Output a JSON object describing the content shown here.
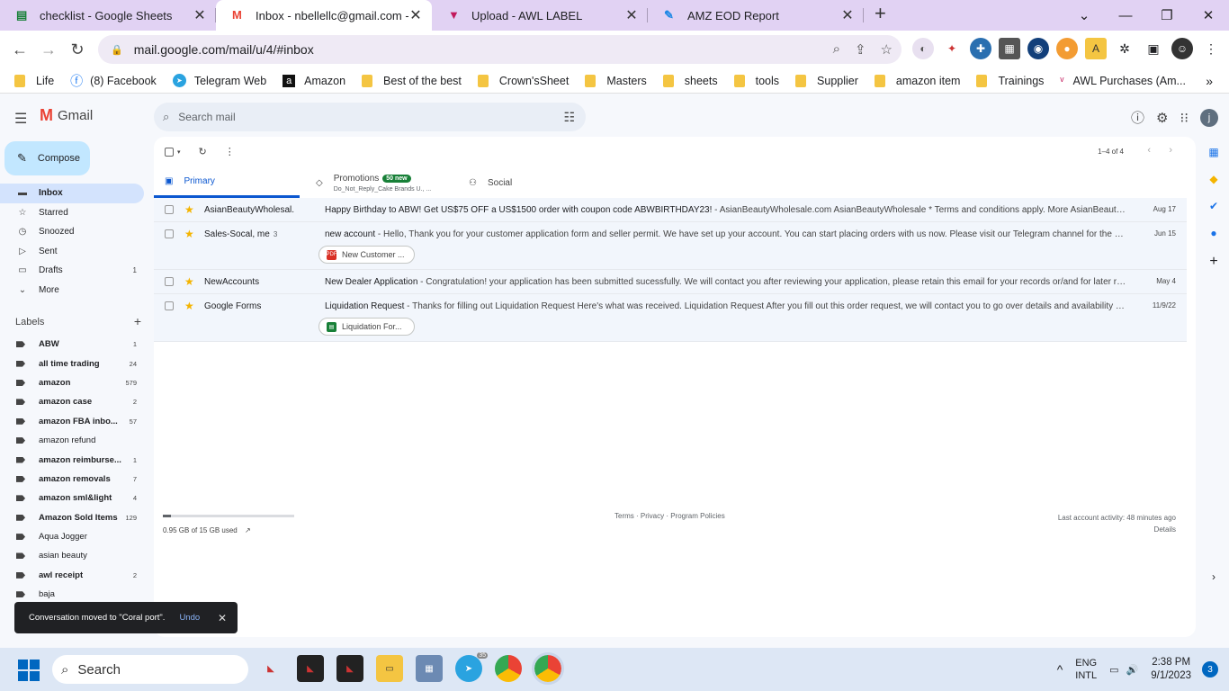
{
  "browser": {
    "tabs": [
      {
        "title": "checklist - Google Sheets",
        "icon": "sheets-icon"
      },
      {
        "title": "Inbox - nbellellc@gmail.com - Gm",
        "icon": "gmail-icon",
        "active": true
      },
      {
        "title": "Upload - AWL LABEL",
        "icon": "awl-icon"
      },
      {
        "title": "AMZ EOD Report",
        "icon": "report-icon"
      }
    ],
    "url": "mail.google.com/mail/u/4/#inbox",
    "bookmarks": [
      "Life",
      "(8) Facebook",
      "Telegram Web",
      "Amazon",
      "Best of the best",
      "Crown'sSheet",
      "Masters",
      "sheets",
      "tools",
      "Supplier",
      "amazon item",
      "Trainings",
      "AWL Purchases (Am..."
    ]
  },
  "gmail": {
    "brand": "Gmail",
    "search_placeholder": "Search mail",
    "avatar_letter": "j",
    "compose": "Compose",
    "nav": [
      {
        "label": "Inbox",
        "icon": "inbox-icon",
        "active": true
      },
      {
        "label": "Starred",
        "icon": "star-icon"
      },
      {
        "label": "Snoozed",
        "icon": "clock-icon"
      },
      {
        "label": "Sent",
        "icon": "send-icon"
      },
      {
        "label": "Drafts",
        "icon": "draft-icon",
        "count": "1"
      },
      {
        "label": "More",
        "icon": "chevron-down-icon"
      }
    ],
    "labels_title": "Labels",
    "labels": [
      {
        "name": "ABW",
        "count": "1",
        "bold": true
      },
      {
        "name": "all time trading",
        "count": "24",
        "bold": true
      },
      {
        "name": "amazon",
        "count": "579",
        "bold": true
      },
      {
        "name": "amazon case",
        "count": "2",
        "bold": true
      },
      {
        "name": "amazon FBA inbo...",
        "count": "57",
        "bold": true
      },
      {
        "name": "amazon refund",
        "count": "",
        "bold": false
      },
      {
        "name": "amazon reimburse...",
        "count": "1",
        "bold": true
      },
      {
        "name": "amazon removals",
        "count": "7",
        "bold": true
      },
      {
        "name": "amazon sml&light",
        "count": "4",
        "bold": true
      },
      {
        "name": "Amazon Sold Items",
        "count": "129",
        "bold": true
      },
      {
        "name": "Aqua Jogger",
        "count": "",
        "bold": false
      },
      {
        "name": "asian beauty",
        "count": "",
        "bold": false
      },
      {
        "name": "awl receipt",
        "count": "2",
        "bold": true
      },
      {
        "name": "baja",
        "count": "",
        "bold": false
      }
    ],
    "pager": "1–4 of 4",
    "tabs": {
      "primary": "Primary",
      "promotions": "Promotions",
      "promotions_badge": "50 new",
      "promotions_sub": "Do_Not_Reply_Cake Brands U., ...",
      "social": "Social"
    },
    "emails": [
      {
        "from": "AsianBeautyWholesal.",
        "from_count": "",
        "subject": "Happy Birthday to ABW! Get US$75 OFF a US$1500 order with coupon code ABWBIRTHDAY23!",
        "snippet": " - AsianBeautyWholesale.com AsianBeautyWholesale * Terms and conditions apply. More AsianBeautyWholesale O...",
        "date": "Aug 17",
        "attachment": "",
        "att_type": ""
      },
      {
        "from": "Sales-Socal, me",
        "from_count": "3",
        "subject": "new account",
        "snippet": " - Hello, Thank you for your customer application form and seller permit. We have set up your account. You can start placing orders with us now. Please visit our Telegram channel for the most updat...",
        "date": "Jun 15",
        "attachment": "New Customer ...",
        "att_type": "PDF"
      },
      {
        "from": "NewAccounts",
        "from_count": "",
        "subject": "New Dealer Application",
        "snippet": " - Congratulation! your application has been submitted sucessfully. We will contact you after reviewing your application, please retain this email for your records or/and for later reference. ...",
        "date": "May 4",
        "attachment": "",
        "att_type": ""
      },
      {
        "from": "Google Forms",
        "from_count": "",
        "subject": "Liquidation Request",
        "snippet": " - Thanks for filling out Liquidation Request Here's what was received. Liquidation Request After you fill out this order request, we will contact you to go over details and availability before the",
        "date": "11/9/22",
        "attachment": "Liquidation For...",
        "att_type": "sheet"
      }
    ],
    "storage": {
      "text": "0.95 GB of 15 GB used",
      "fraction": 0.063
    },
    "footer_links": "Terms · Privacy · Program Policies",
    "activity": "Last account activity: 48 minutes ago",
    "details": "Details",
    "toast": {
      "text": "Conversation moved to \"Coral port\".",
      "undo": "Undo"
    }
  },
  "taskbar": {
    "search": "Search",
    "lang1": "ENG",
    "lang2": "INTL",
    "time": "2:38 PM",
    "date": "9/1/2023",
    "notifications": "3",
    "telegram_badge": "35"
  }
}
